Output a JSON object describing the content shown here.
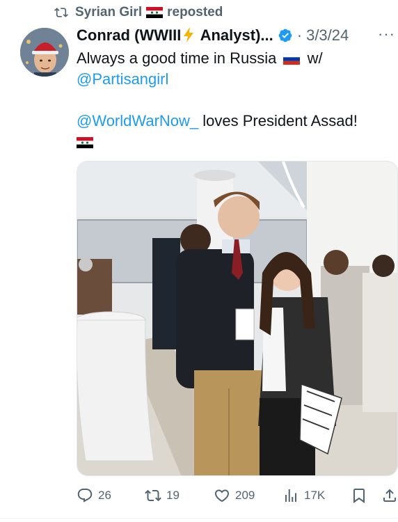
{
  "repost": {
    "user": "Syrian Girl",
    "label": "reposted"
  },
  "tweet": {
    "author_name": "Conrad (WWIII",
    "author_name_suffix": " Analyst)...",
    "date": "3/3/24",
    "more": "···",
    "text_line1": "Always a good time in Russia",
    "text_line1_after": " w/",
    "mention1": "@Partisangirl",
    "mention2": "@WorldWarNow_",
    "text_line4_after": " loves President Assad!"
  },
  "actions": {
    "replies": "26",
    "reposts": "19",
    "likes": "209",
    "views": "17K"
  },
  "colors": {
    "accent": "#1d9bf0",
    "muted": "#536471",
    "text": "#0f1419"
  },
  "icons": [
    "repost-icon",
    "syria-flag-icon",
    "verified-badge-icon",
    "lightning-icon",
    "russia-flag-icon",
    "more-icon",
    "reply-icon",
    "like-icon",
    "views-icon",
    "bookmark-icon",
    "share-icon"
  ]
}
